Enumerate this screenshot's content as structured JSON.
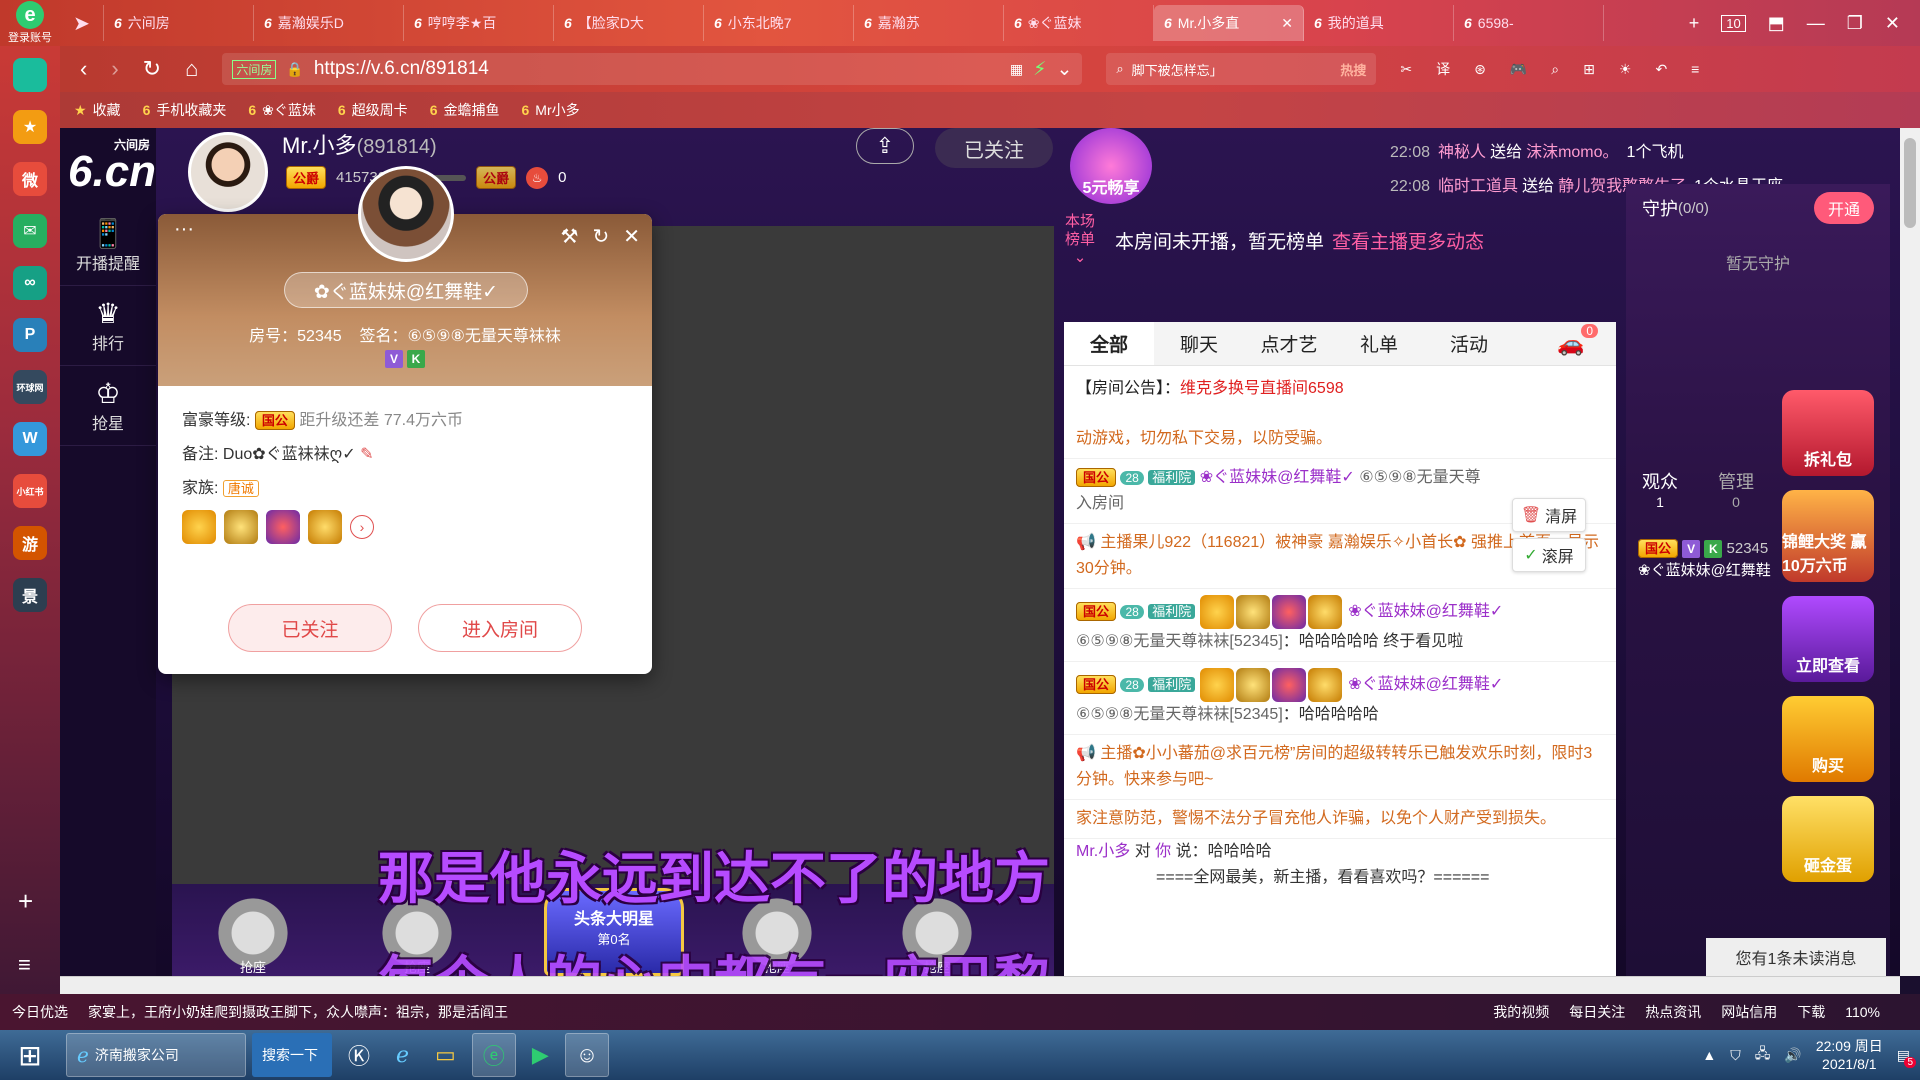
{
  "browser": {
    "login_label": "登录账号",
    "tabs": [
      {
        "label": "六间房",
        "active": false
      },
      {
        "label": "嘉瀚娱乐D",
        "active": false
      },
      {
        "label": "哼哼李★百",
        "active": false
      },
      {
        "label": "【脸家D大",
        "active": false
      },
      {
        "label": "小东北晚7",
        "active": false
      },
      {
        "label": "嘉瀚苏",
        "active": false
      },
      {
        "label": "❀ぐ蓝妹",
        "active": false
      },
      {
        "label": "Mr.小多直",
        "active": true
      },
      {
        "label": "我的道具",
        "active": false
      },
      {
        "label": "6598-",
        "active": false
      }
    ],
    "tab_count": "10",
    "url": "https://v.6.cn/891814",
    "site_badge": "六间房",
    "search_placeholder": "脚下被怎样忘」",
    "search_hot": "热搜",
    "bookmarks": [
      "收藏",
      "手机收藏夹",
      "❀ぐ蓝妹",
      "超级周卡",
      "金蟾捕鱼",
      "Mr小多"
    ]
  },
  "sidebar": {
    "apps": [
      {
        "label": "",
        "color": "#1abc9c"
      },
      {
        "label": "★",
        "color": "#f39c12"
      },
      {
        "label": "微",
        "color": "#e74c3c"
      },
      {
        "label": "✉",
        "color": "#27ae60"
      },
      {
        "label": "∞",
        "color": "#16a085"
      },
      {
        "label": "P",
        "color": "#2980b9"
      },
      {
        "label": "环球网",
        "color": "#34495e"
      },
      {
        "label": "W",
        "color": "#3498db"
      },
      {
        "label": "小红书",
        "color": "#e74c3c"
      },
      {
        "label": "游",
        "color": "#d35400"
      },
      {
        "label": "景",
        "color": "#2c3e50"
      }
    ]
  },
  "site": {
    "logo_sub": "六间房",
    "logo": "6.cn",
    "nav": [
      {
        "label": "开播提醒",
        "icon": "📱"
      },
      {
        "label": "排行",
        "icon": "♛"
      },
      {
        "label": "抢星",
        "icon": "♔"
      }
    ]
  },
  "anchor": {
    "name": "Mr.小多",
    "id": "(891814)",
    "badge": "公爵",
    "fans": "415732",
    "fire_count": "0",
    "follow_label": "已关注",
    "promo_label": "5元畅享"
  },
  "gift_feed": [
    {
      "time": "22:08",
      "user": "神秘人",
      "verb": "送给",
      "target": "沫沫momo。",
      "gift": "1个飞机"
    },
    {
      "time": "22:08",
      "user": "临时工道具",
      "verb": "送给",
      "target": "静儿贺我憨憨生了",
      "gift": "1个水晶王座"
    }
  ],
  "rank": {
    "label": "本场\n榜单",
    "text": "本房间未开播，暂无榜单",
    "more": "查看主播更多动态"
  },
  "chat": {
    "tabs": [
      "全部",
      "聊天",
      "点才艺",
      "礼单",
      "活动"
    ],
    "car_count": "0",
    "notice_prefix": "【房间公告】：",
    "notice_text": "维克多换号直播间6598",
    "warn_text": "动游戏，切勿私下交易，以防受骗。",
    "enter_user": "❀ぐ蓝妹妹@红舞鞋✓",
    "enter_sign": "⑥⑤⑨⑧无量天尊",
    "enter_tail": "入房间",
    "badge_gov": "国公",
    "level": "28",
    "family": "福利院",
    "bulletin1": "主播果儿922（116821）被神豪 嘉瀚娱乐✧小首长✿ 强推上首页，显示30分钟。",
    "msg_user": "❀ぐ蓝妹妹@红舞鞋✓",
    "msg_sign": "⑥⑤⑨⑧无量天尊袜袜",
    "msg_rid": "[52345]",
    "msg1": "：哈哈哈哈哈 终于看见啦",
    "msg2": "：哈哈哈哈哈",
    "bulletin2": "主播✿小小蕃茄@求百元榜”房间的超级转转乐已触发欢乐时刻，限时3分钟。快来参与吧~",
    "safety": "家注意防范，警惕不法分子冒充他人诈骗，以免个人财产受到损失。",
    "to_line_user": "Mr.小多",
    "to_line_mid": "对",
    "to_line_you": "你",
    "to_line_text": "说：哈哈哈哈",
    "last_line": "====全网最美，新主播，看看喜欢吗？======",
    "clear_btn": "清屏",
    "scroll_btn": "滚屏"
  },
  "guard": {
    "title": "守护",
    "count": "(0/0)",
    "open_btn": "开通",
    "empty": "暂无守护",
    "audience_label": "观众",
    "audience_count": "1",
    "admin_label": "管理",
    "admin_count": "0",
    "viewer_badge": "国公",
    "viewer_id": "52345",
    "viewer_name": "❀ぐ蓝妹妹@红舞鞋",
    "unread": "您有1条未读消息",
    "promos": [
      "拆礼包",
      "锦鲤大奖 赢10万六币",
      "立即查看",
      "购买",
      "砸金蛋"
    ]
  },
  "card": {
    "name": "✿ぐ蓝妹妹@红舞鞋✓",
    "room_label": "房号：",
    "room_no": "52345",
    "sign_label": "签名：",
    "sign": "⑥⑤⑨⑧无量天尊袜袜",
    "wealth_label": "富豪等级:",
    "wealth_badge": "国公",
    "wealth_gap": "距升级还差 77.4万六币",
    "remark_label": "备注:",
    "remark": "Duo✿ぐ蓝袜袜ღ✓",
    "family_label": "家族:",
    "family": "唐诚",
    "followed_btn": "已关注",
    "enter_btn": "进入房间"
  },
  "seats": {
    "label": "抢座",
    "center_badge": "头条大明星",
    "center_sub": "第0名"
  },
  "subtitles": {
    "line1": "那是他永远到达不了的地方",
    "line2": "每个人的心中都有一座巴黎"
  },
  "status": {
    "items": [
      "今日优选",
      "家宴上，王府小奶娃爬到摄政王脚下，众人噤声：祖宗，那是活阎王",
      "我的视频",
      "每日关注",
      "热点资讯",
      "网站信用",
      "下载",
      "110%"
    ]
  },
  "taskbar": {
    "tasks": [
      "济南搬家公司",
      "搜索一下"
    ],
    "clock_time": "22:09 周日",
    "clock_date": "2021/8/1",
    "notif": "5"
  }
}
